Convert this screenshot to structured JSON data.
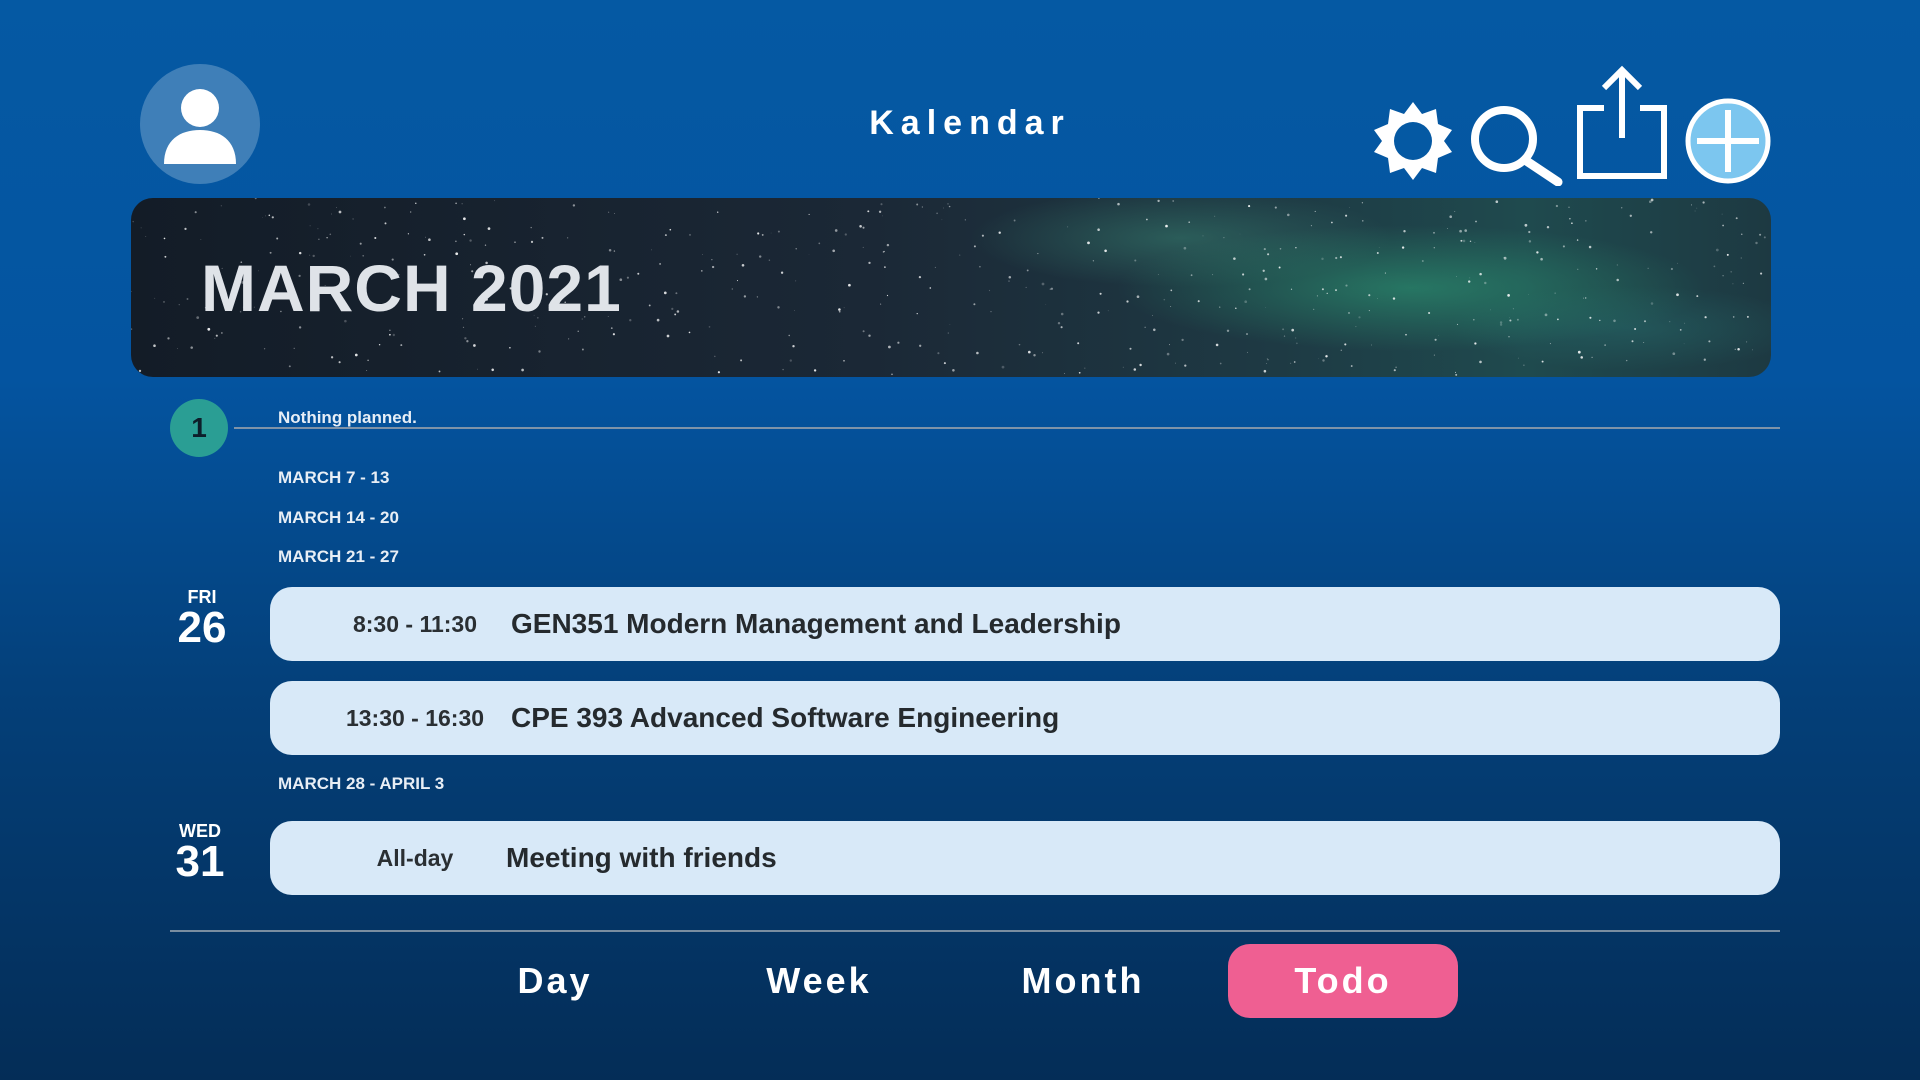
{
  "header": {
    "app_title": "Kalendar",
    "icons": [
      "user-avatar-icon",
      "settings-gear-icon",
      "search-icon",
      "share-icon",
      "add-icon"
    ]
  },
  "banner": {
    "month_title": "MARCH 2021"
  },
  "agenda": {
    "first_day": {
      "day_number": "1",
      "note": "Nothing planned."
    },
    "weeks": [
      {
        "label": "MARCH 7 - 13"
      },
      {
        "label": "MARCH 14 - 20"
      },
      {
        "label": "MARCH 21 - 27"
      },
      {
        "label": "MARCH 28 - APRIL 3"
      }
    ],
    "days": [
      {
        "weekday": "FRI",
        "date": "26",
        "events": [
          {
            "time": "8:30 - 11:30",
            "title": "GEN351 Modern Management and Leadership"
          },
          {
            "time": "13:30 - 16:30",
            "title": "CPE 393 Advanced Software Engineering"
          }
        ]
      },
      {
        "weekday": "WED",
        "date": "31",
        "events": [
          {
            "time": "All-day",
            "title": "Meeting with friends"
          }
        ]
      }
    ]
  },
  "nav": {
    "tabs": [
      {
        "label": "Day",
        "active": false
      },
      {
        "label": "Week",
        "active": false
      },
      {
        "label": "Month",
        "active": false
      },
      {
        "label": "Todo",
        "active": true
      }
    ]
  },
  "colors": {
    "background_top": "#0559a3",
    "background_bottom": "#042d57",
    "event_card": "#d8e9f8",
    "active_tab": "#ef5f92",
    "day_circle": "#2a9e94",
    "add_button": "#7cc6ef"
  }
}
